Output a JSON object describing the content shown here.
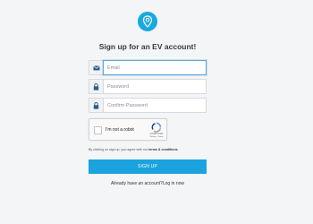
{
  "logo": {
    "icon": "ev-charger-pin-icon",
    "color": "#19a9e0"
  },
  "title": "Sign up for an EV account!",
  "fields": {
    "email": {
      "placeholder": "Email",
      "value": "",
      "icon": "envelope-icon"
    },
    "password": {
      "placeholder": "Password",
      "value": "",
      "icon": "lock-icon"
    },
    "confirm_password": {
      "placeholder": "Confirm Password",
      "value": "",
      "icon": "lock-icon"
    }
  },
  "captcha": {
    "label": "I'm not a robot",
    "brand": "reCAPTCHA",
    "links": "Privacy - Terms"
  },
  "terms": {
    "prefix": "By clicking on sign up, you agree with our",
    "link_text": "terms & conditions"
  },
  "signup_button": {
    "label": "SIGN UP",
    "color": "#1aa3dd"
  },
  "login": {
    "prefix": "Already have an account?",
    "link_text": "Log in now"
  }
}
